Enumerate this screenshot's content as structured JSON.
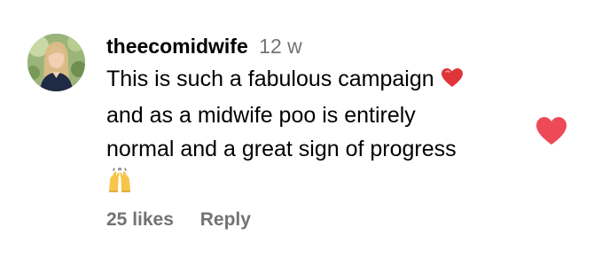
{
  "comment": {
    "username": "theecomidwife",
    "timestamp": "12 w",
    "text_lines": [
      "This is such a fabulous campaign",
      "and as a midwife poo is entirely",
      "normal and a great sign of progress"
    ],
    "emoji_heart": "red-heart-emoji",
    "emoji_hands": "raising-hands-emoji",
    "likes_label": "25 likes",
    "reply_label": "Reply",
    "like_icon": "heart-icon",
    "like_state": "liked",
    "like_color": "#ed4956"
  }
}
